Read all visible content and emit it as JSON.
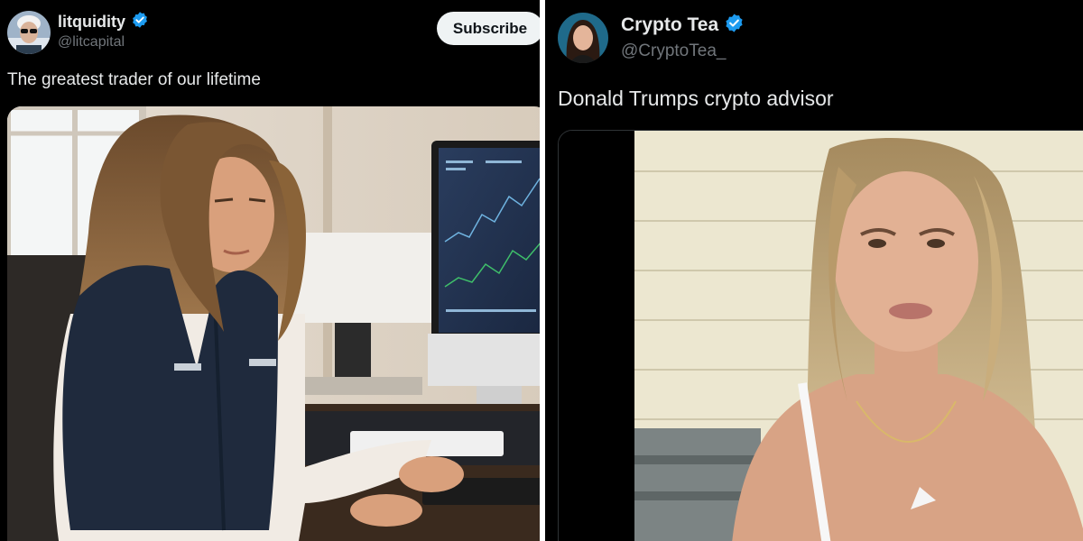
{
  "left_tweet": {
    "display_name": "litquidity",
    "handle": "@litcapital",
    "subscribe_label": "Subscribe",
    "text": "The greatest trader of our lifetime",
    "verified": true,
    "avatar_icon": "man-with-sunglasses-avatar",
    "media_icon": "woman-at-trading-desk-photo"
  },
  "right_tweet": {
    "display_name": "Crypto Tea",
    "handle": "@CryptoTea_",
    "text": "Donald Trumps crypto advisor",
    "verified": true,
    "avatar_icon": "woman-portrait-avatar",
    "media_icon": "woman-video-still"
  },
  "colors": {
    "verified_blue": "#1d9bf0",
    "background": "#000000",
    "subscribe_bg": "#eff3f4"
  }
}
